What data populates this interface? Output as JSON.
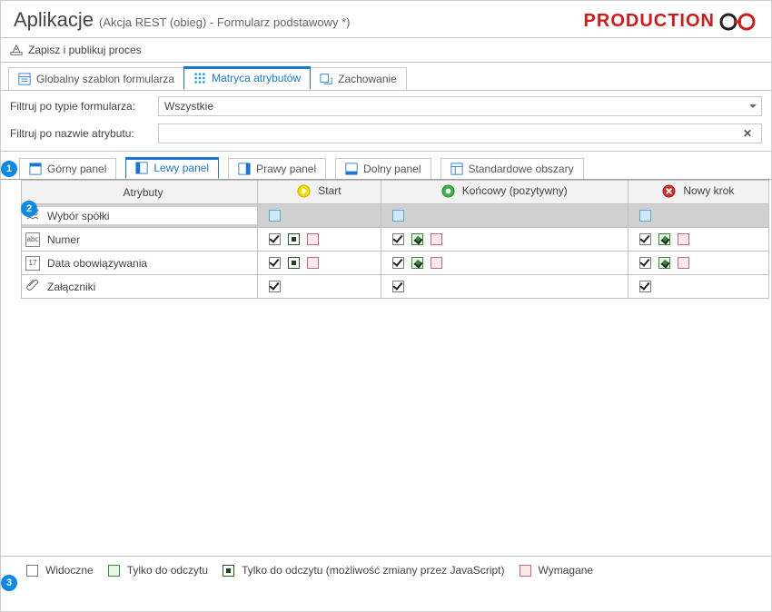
{
  "title": "Aplikacje",
  "context": "(Akcja REST (obieg) - Formularz podstawowy *)",
  "brand": "PRODUCTION",
  "toolbar": {
    "save_publish": "Zapisz i publikuj proces"
  },
  "main_tabs": {
    "global": "Globalny szablon formularza",
    "matrix": "Matryca atrybutów",
    "behavior": "Zachowanie"
  },
  "filters": {
    "form_type_label": "Filtruj po typie formularza:",
    "form_type_value": "Wszystkie",
    "attr_name_label": "Filtruj po nazwie atrybutu:",
    "attr_name_value": ""
  },
  "panel_tabs": {
    "top": "Górny panel",
    "left": "Lewy panel",
    "right": "Prawy panel",
    "bottom": "Dolny panel",
    "standard": "Standardowe obszary"
  },
  "columns": {
    "attributes": "Atrybuty",
    "steps": [
      {
        "id": "start",
        "label": "Start",
        "kind": "start"
      },
      {
        "id": "end_pos",
        "label": "Końcowy (pozytywny)",
        "kind": "end"
      },
      {
        "id": "new",
        "label": "Nowy krok",
        "kind": "error"
      }
    ]
  },
  "rows": [
    {
      "icon": "company",
      "name": "Wybór spółki",
      "disabled": true,
      "cells": [
        {
          "visible": false
        },
        {
          "visible": false
        },
        {
          "visible": false
        }
      ]
    },
    {
      "icon": "text",
      "name": "Numer",
      "cells": [
        {
          "visible": true,
          "ro_dark": true,
          "req": false
        },
        {
          "visible": true,
          "ro_light": true,
          "req": false
        },
        {
          "visible": true,
          "ro_light": true,
          "req": false
        }
      ]
    },
    {
      "icon": "date",
      "name": "Data obowiązywania",
      "cells": [
        {
          "visible": true,
          "ro_dark": true,
          "req": false
        },
        {
          "visible": true,
          "ro_light": true,
          "req": false
        },
        {
          "visible": true,
          "ro_light": true,
          "req": false
        }
      ]
    },
    {
      "icon": "attach",
      "name": "Załączniki",
      "cells": [
        {
          "visible": true
        },
        {
          "visible": true
        },
        {
          "visible": true
        }
      ]
    }
  ],
  "legend": {
    "visible": "Widoczne",
    "ro": "Tylko do odczytu",
    "ro_js": "Tylko do odczytu (możliwość zmiany przez JavaScript)",
    "req": "Wymagane"
  },
  "callouts": {
    "n1": "1",
    "n2": "2",
    "n3": "3"
  }
}
